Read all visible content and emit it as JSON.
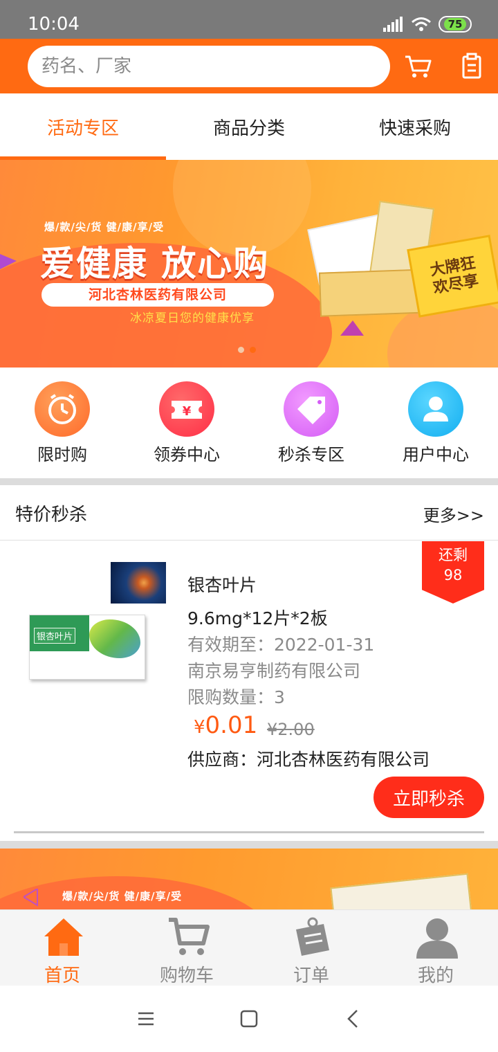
{
  "status_bar": {
    "time": "10:04",
    "battery": "75"
  },
  "search": {
    "placeholder": "药名、厂家"
  },
  "header_icons": [
    "cart-icon",
    "clipboard-icon"
  ],
  "tabs": [
    {
      "label": "活动专区",
      "active": true
    },
    {
      "label": "商品分类",
      "active": false
    },
    {
      "label": "快速采购",
      "active": false
    }
  ],
  "banner": {
    "tagline": "爆/款/尖/货 健/康/享/受",
    "headline": "爱健康 放心购",
    "company": "河北杏林医药有限公司",
    "subline": "冰凉夏日您的健康优享",
    "promo_line1": "大牌狂",
    "promo_line2": "欢尽享",
    "page": 2,
    "pages": 2
  },
  "quick_nav": [
    {
      "label": "限时购",
      "icon": "alarm-clock-icon",
      "color": "#ff6a2a"
    },
    {
      "label": "领券中心",
      "icon": "coupon-icon",
      "color": "#ff3a3a"
    },
    {
      "label": "秒杀专区",
      "icon": "flash-sale-tag-icon",
      "color": "#e070ff"
    },
    {
      "label": "用户中心",
      "icon": "user-icon",
      "color": "#1ab8f0"
    }
  ],
  "flash_sale": {
    "title": "特价秒杀",
    "more": "更多>>",
    "product": {
      "name": "银杏叶片",
      "pack_name": "银杏叶片",
      "spec": "9.6mg*12片*2板",
      "expiry": "有效期至：2022-01-31",
      "manufacturer": "南京易亨制药有限公司",
      "limit": "限购数量：3",
      "price_symbol": "¥",
      "price": "0.01",
      "original_price": "¥2.00",
      "supplier": "供应商：河北杏林医药有限公司",
      "buy_label": "立即秒杀",
      "stock_label": "还剩",
      "stock": "98"
    }
  },
  "banner2": {
    "tagline": "爆/款/尖/货 健/康/享/受"
  },
  "bottom_nav": [
    {
      "label": "首页",
      "icon": "home-icon",
      "active": true
    },
    {
      "label": "购物车",
      "icon": "cart-icon",
      "active": false
    },
    {
      "label": "订单",
      "icon": "order-icon",
      "active": false
    },
    {
      "label": "我的",
      "icon": "profile-icon",
      "active": false
    }
  ],
  "colors": {
    "accent": "#ff6a12",
    "sale_red": "#ff2d1a",
    "muted": "#8a8a8a"
  }
}
